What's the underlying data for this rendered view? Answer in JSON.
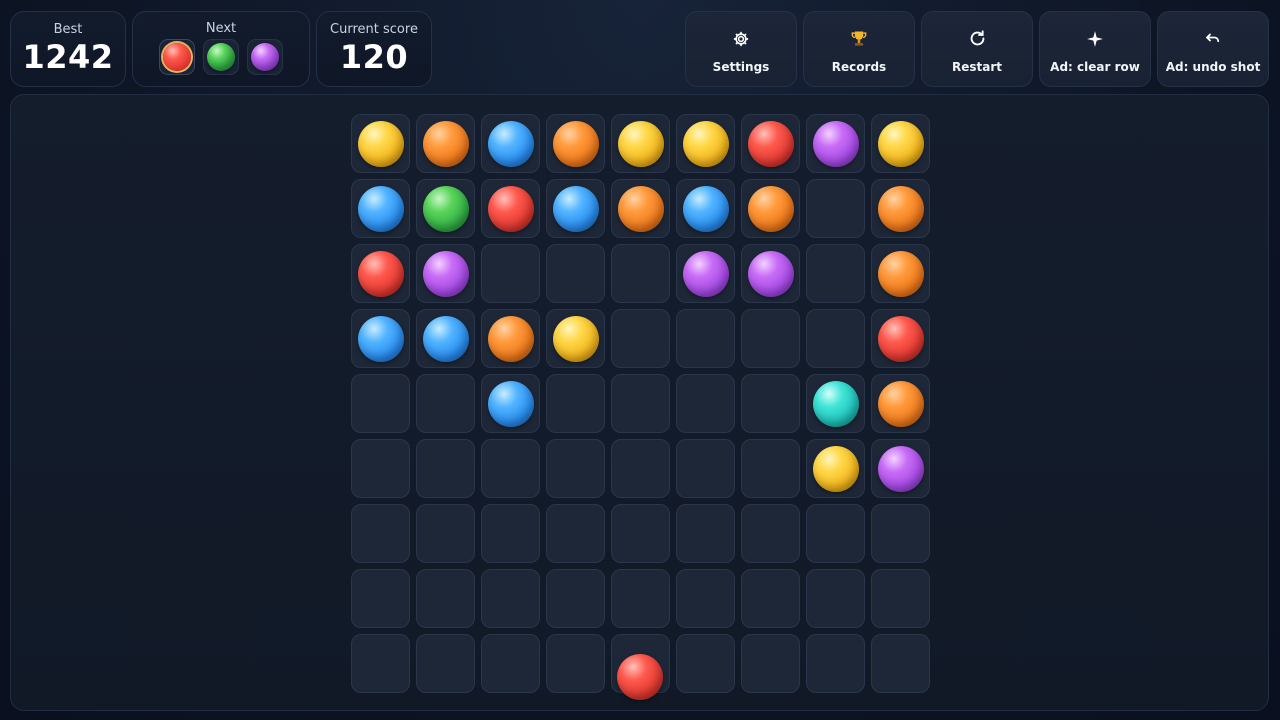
{
  "stats": {
    "best_label": "Best",
    "best_value": "1242",
    "next_label": "Next",
    "current_label": "Current score",
    "current_value": "120"
  },
  "next_balls": [
    "red",
    "green",
    "purple"
  ],
  "buttons": {
    "settings": "Settings",
    "records": "Records",
    "restart": "Restart",
    "clear_row": "Ad: clear row",
    "undo_shot": "Ad: undo shot"
  },
  "icons": {
    "settings": "gear-icon",
    "records": "trophy-icon",
    "restart": "restart-icon",
    "clear_row": "sparkle-icon",
    "undo_shot": "undo-icon"
  },
  "board": {
    "rows": 9,
    "cols": 9,
    "cells": [
      [
        "yellow",
        "orange",
        "blue",
        "orange",
        "yellow",
        "yellow",
        "red",
        "purple",
        "yellow"
      ],
      [
        "blue",
        "green",
        "red",
        "blue",
        "orange",
        "blue",
        "orange",
        "",
        "orange"
      ],
      [
        "red",
        "purple",
        "",
        "",
        "",
        "purple",
        "purple",
        "",
        "orange"
      ],
      [
        "blue",
        "blue",
        "orange",
        "yellow",
        "",
        "",
        "",
        "",
        "red"
      ],
      [
        "",
        "",
        "blue",
        "",
        "",
        "",
        "",
        "cyan",
        "orange"
      ],
      [
        "",
        "",
        "",
        "",
        "",
        "",
        "",
        "yellow",
        "purple"
      ],
      [
        "",
        "",
        "",
        "",
        "",
        "",
        "",
        "",
        ""
      ],
      [
        "",
        "",
        "",
        "",
        "",
        "",
        "",
        "",
        ""
      ],
      [
        "",
        "",
        "",
        "",
        "",
        "",
        "",
        "",
        ""
      ]
    ]
  },
  "shooter_ball": "red"
}
